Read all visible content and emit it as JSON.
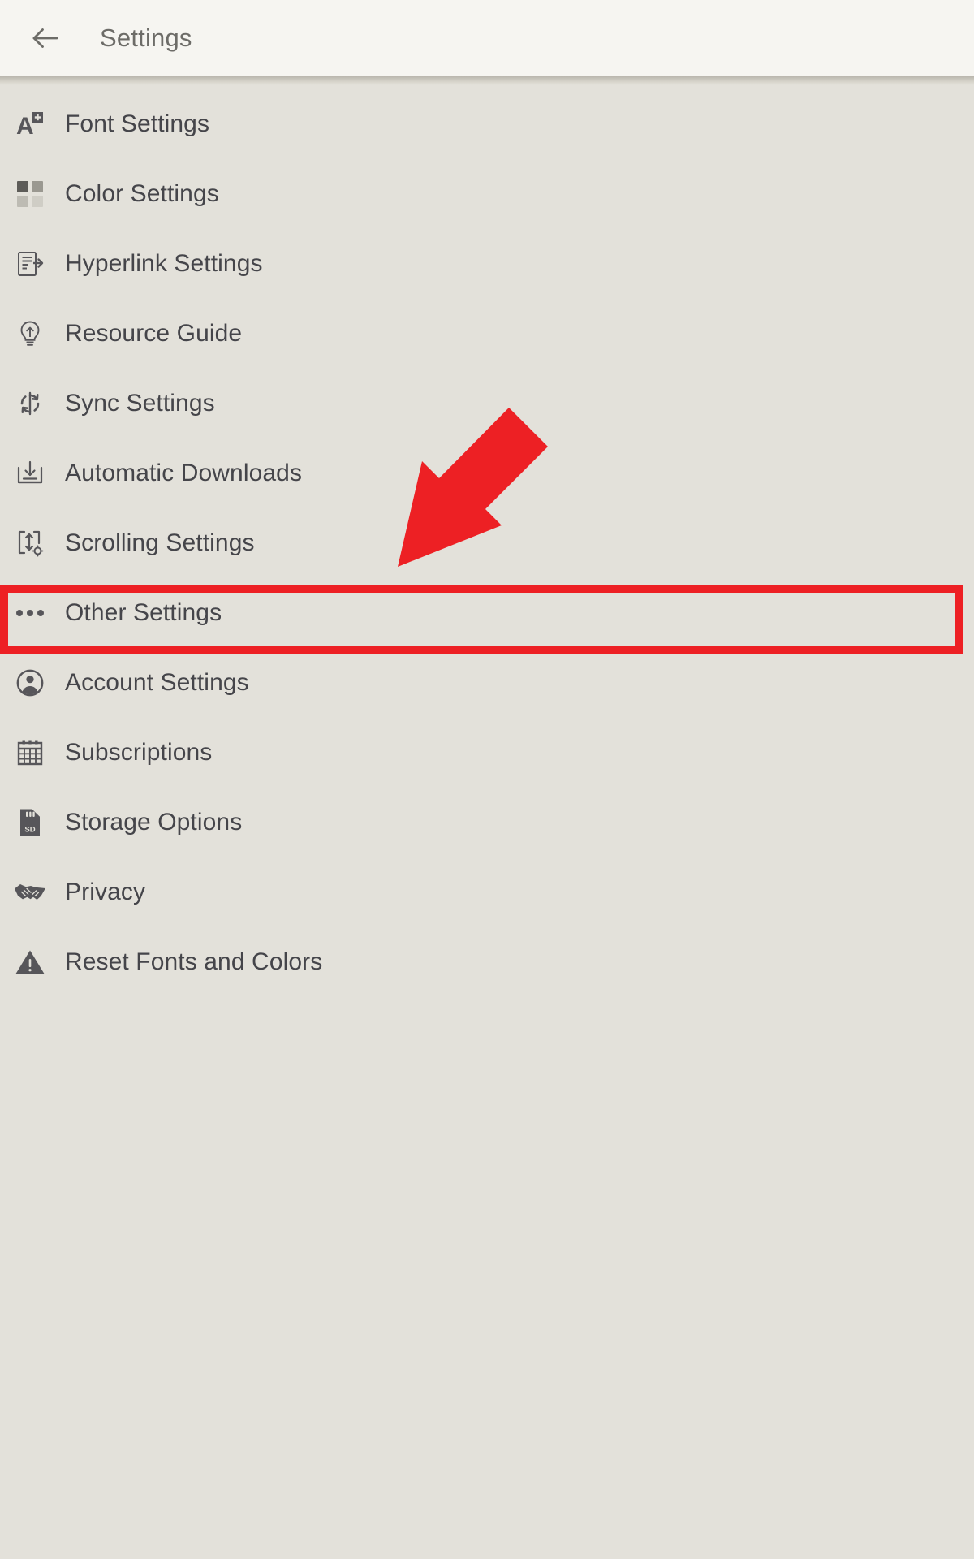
{
  "header": {
    "title": "Settings",
    "back_icon": "arrow-left-icon"
  },
  "colors": {
    "page_background": "#e3e1da",
    "header_background": "#f6f5f1",
    "label_text": "#45454a",
    "title_text": "#6d6c68",
    "icon": "#57565a",
    "annotation_red": "#ed2024"
  },
  "annotation": {
    "arrow": "red-arrow-down-left",
    "highlight_target": "Other Settings"
  },
  "settings_list": [
    {
      "label": "Font Settings",
      "icon": "font-size-icon"
    },
    {
      "label": "Color Settings",
      "icon": "color-grid-icon"
    },
    {
      "label": "Hyperlink Settings",
      "icon": "document-link-icon"
    },
    {
      "label": "Resource Guide",
      "icon": "lightbulb-icon"
    },
    {
      "label": "Sync Settings",
      "icon": "sync-refresh-icon"
    },
    {
      "label": "Automatic Downloads",
      "icon": "download-tray-icon"
    },
    {
      "label": "Scrolling Settings",
      "icon": "scroll-gear-icon"
    },
    {
      "label": "Other Settings",
      "icon": "ellipsis-icon",
      "highlighted": true
    },
    {
      "label": "Account Settings",
      "icon": "user-circle-icon"
    },
    {
      "label": "Subscriptions",
      "icon": "calendar-icon"
    },
    {
      "label": "Storage Options",
      "icon": "sd-card-icon"
    },
    {
      "label": "Privacy",
      "icon": "handshake-icon"
    },
    {
      "label": "Reset Fonts and Colors",
      "icon": "warning-triangle-icon"
    }
  ]
}
